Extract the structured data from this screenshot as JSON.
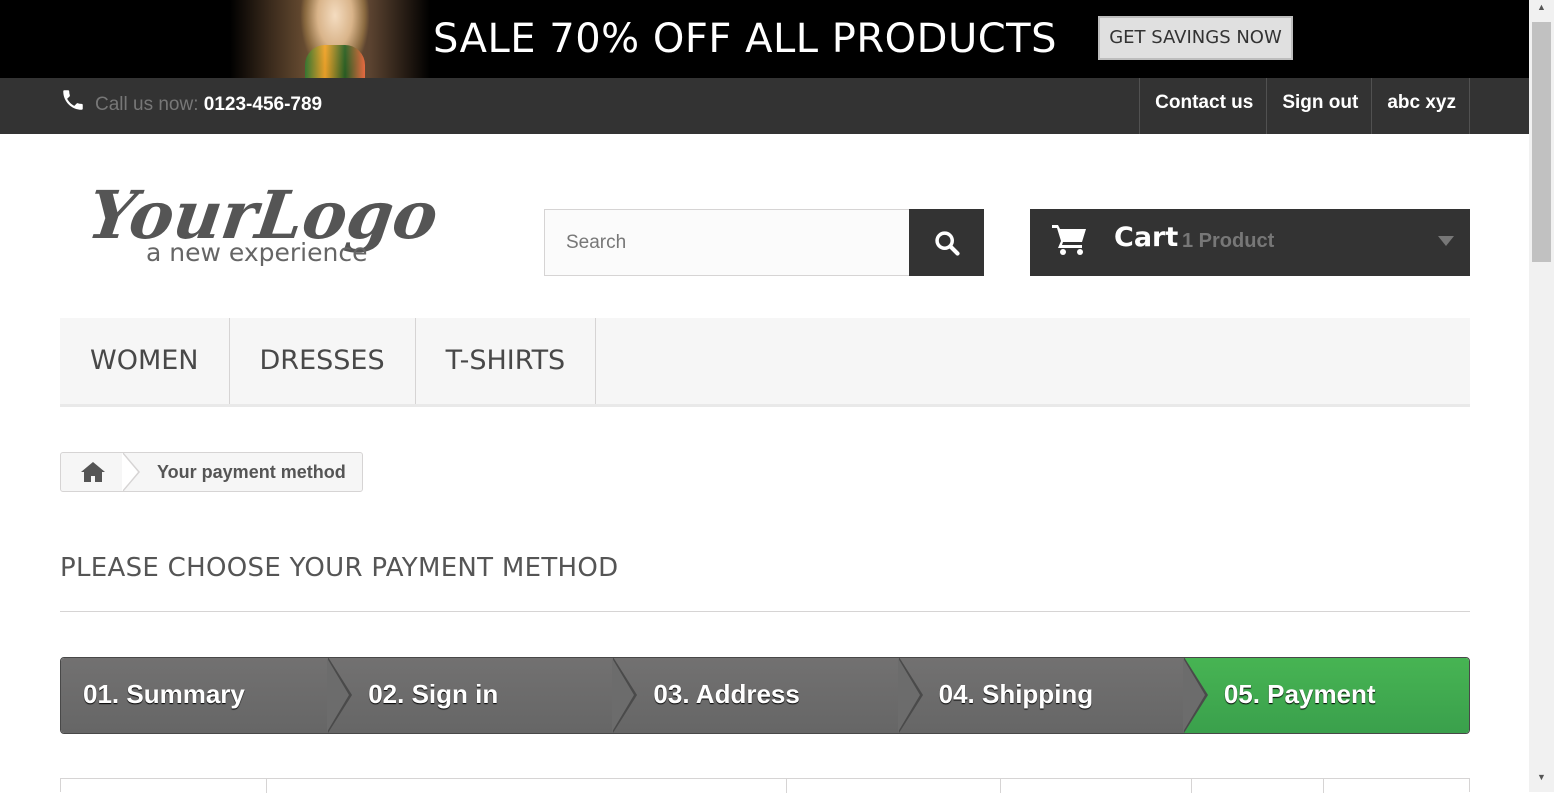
{
  "banner": {
    "text": "SALE 70% OFF ALL PRODUCTS",
    "button_label": "GET SAVINGS NOW"
  },
  "topnav": {
    "call_label": "Call us now: ",
    "phone": "0123-456-789",
    "links": [
      "Contact us",
      "Sign out",
      "abc xyz"
    ]
  },
  "logo": {
    "line1": "YourLogo",
    "line2": "a new experience"
  },
  "search": {
    "placeholder": "Search"
  },
  "cart": {
    "label": "Cart",
    "quantity": "1 Product"
  },
  "menu": [
    "WOMEN",
    "DRESSES",
    "T-SHIRTS"
  ],
  "breadcrumb": {
    "current": "Your payment method"
  },
  "page_heading": "PLEASE CHOOSE YOUR PAYMENT METHOD",
  "steps": [
    "01. Summary",
    "02. Sign in",
    "03. Address",
    "04. Shipping",
    "05. Payment"
  ],
  "active_step": 5,
  "colors": {
    "dark": "#333333",
    "active_step": "#3aa04c",
    "step": "#666666"
  },
  "icons": [
    "phone-icon",
    "search-icon",
    "cart-icon",
    "home-icon",
    "chevron-down-icon"
  ]
}
